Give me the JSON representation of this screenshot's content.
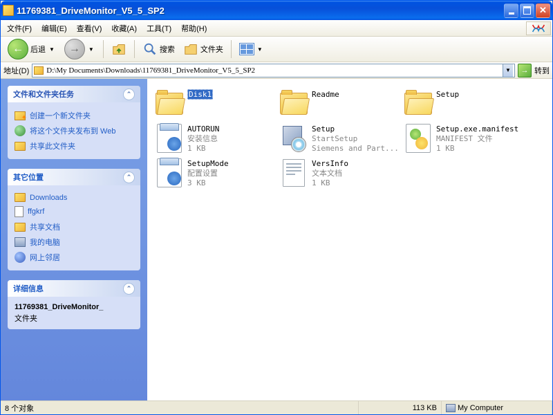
{
  "titlebar": {
    "text": "11769381_DriveMonitor_V5_5_SP2"
  },
  "menus": [
    {
      "label": "文件(F)"
    },
    {
      "label": "编辑(E)"
    },
    {
      "label": "查看(V)"
    },
    {
      "label": "收藏(A)"
    },
    {
      "label": "工具(T)"
    },
    {
      "label": "帮助(H)"
    }
  ],
  "toolbar": {
    "back": "后退",
    "search": "搜索",
    "folders": "文件夹"
  },
  "addressbar": {
    "label": "地址(D)",
    "path": "D:\\My Documents\\Downloads\\11769381_DriveMonitor_V5_5_SP2",
    "go": "转到"
  },
  "sidebar": {
    "tasks": {
      "title": "文件和文件夹任务",
      "items": [
        {
          "label": "创建一个新文件夹",
          "icon": "new-folder"
        },
        {
          "label": "将这个文件夹发布到 Web",
          "icon": "globe"
        },
        {
          "label": "共享此文件夹",
          "icon": "share-folder"
        }
      ]
    },
    "places": {
      "title": "其它位置",
      "items": [
        {
          "label": "Downloads",
          "icon": "folder"
        },
        {
          "label": "ffgkrf",
          "icon": "doc"
        },
        {
          "label": "共享文档",
          "icon": "folder"
        },
        {
          "label": "我的电脑",
          "icon": "pc"
        },
        {
          "label": "网上邻居",
          "icon": "net"
        }
      ]
    },
    "details": {
      "title": "详细信息",
      "name": "11769381_DriveMonitor_",
      "type": "文件夹"
    }
  },
  "files": [
    {
      "name": "Disk1",
      "type": "folder",
      "selected": true
    },
    {
      "name": "Readme",
      "type": "folder"
    },
    {
      "name": "Setup",
      "type": "folder"
    },
    {
      "name": "AUTORUN",
      "meta1": "安装信息",
      "meta2": "1 KB",
      "type": "ini"
    },
    {
      "name": "Setup",
      "meta1": "StartSetup",
      "meta2": "Siemens and Part...",
      "type": "exe"
    },
    {
      "name": "Setup.exe.manifest",
      "meta1": "MANIFEST 文件",
      "meta2": "1 KB",
      "type": "manifest"
    },
    {
      "name": "SetupMode",
      "meta1": "配置设置",
      "meta2": "3 KB",
      "type": "ini"
    },
    {
      "name": "VersInfo",
      "meta1": "文本文档",
      "meta2": "1 KB",
      "type": "txt"
    }
  ],
  "statusbar": {
    "objects": "8 个对象",
    "size": "113 KB",
    "location": "My Computer"
  }
}
